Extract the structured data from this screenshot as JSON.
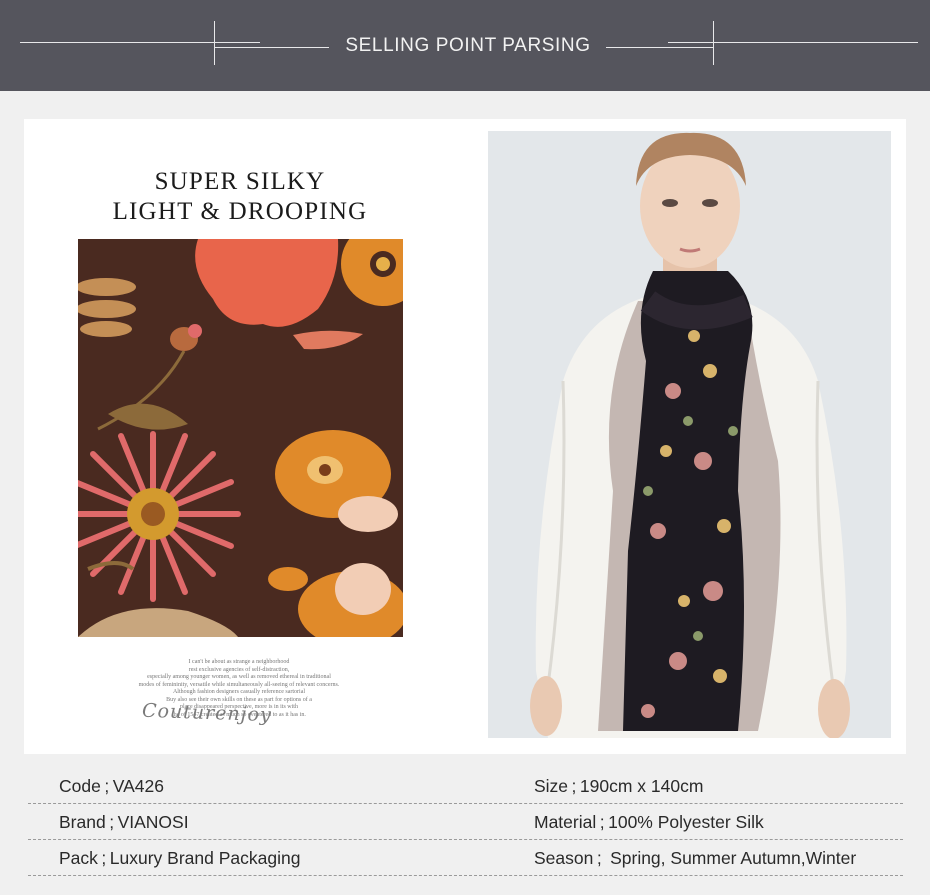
{
  "header": {
    "title": "SELLING POINT PARSING"
  },
  "feature": {
    "headline_line1": "SUPER SILKY",
    "headline_line2": "LIGHT & DROOPING",
    "fine_print": [
      "I can't be about as strange a neighborhood",
      "rest exclusive agencies of self-distraction,",
      "especially among younger women, as well as removed ethereal in traditional",
      "modes of femininity, versatile while simultaneously all-seeing of relevant concerns.",
      "Although fashion designers casually reference sartorial",
      "Buy also see their own skills on these as part for options of a",
      "place disappeared perspective, more is in its with",
      "the of 1547 created as much so eventered to as it has in."
    ],
    "signature": "Couturenjoy"
  },
  "photo": {
    "scarf_colors": {
      "base": "#1e1b22",
      "sheer": "#8a6e68",
      "accent_rose": "#c98a86",
      "accent_gold": "#d7b36a"
    }
  },
  "swatch_colors": {
    "background": "#4a2a20",
    "red_flower": "#e8654b",
    "orange_flower": "#e08a2a",
    "pink_flower": "#e06a6a",
    "leaf": "#8c6a3a"
  },
  "specs": [
    {
      "left": "Code ; VA426",
      "right": "Size ; 190cm x 140cm"
    },
    {
      "left": "Brand ; VIANOSI",
      "right": "Material ; 100% Polyester Silk"
    },
    {
      "left": "Pack ; Luxury Brand Packaging",
      "right": "Season ;  Spring, Summer Autumn,Winter"
    }
  ]
}
